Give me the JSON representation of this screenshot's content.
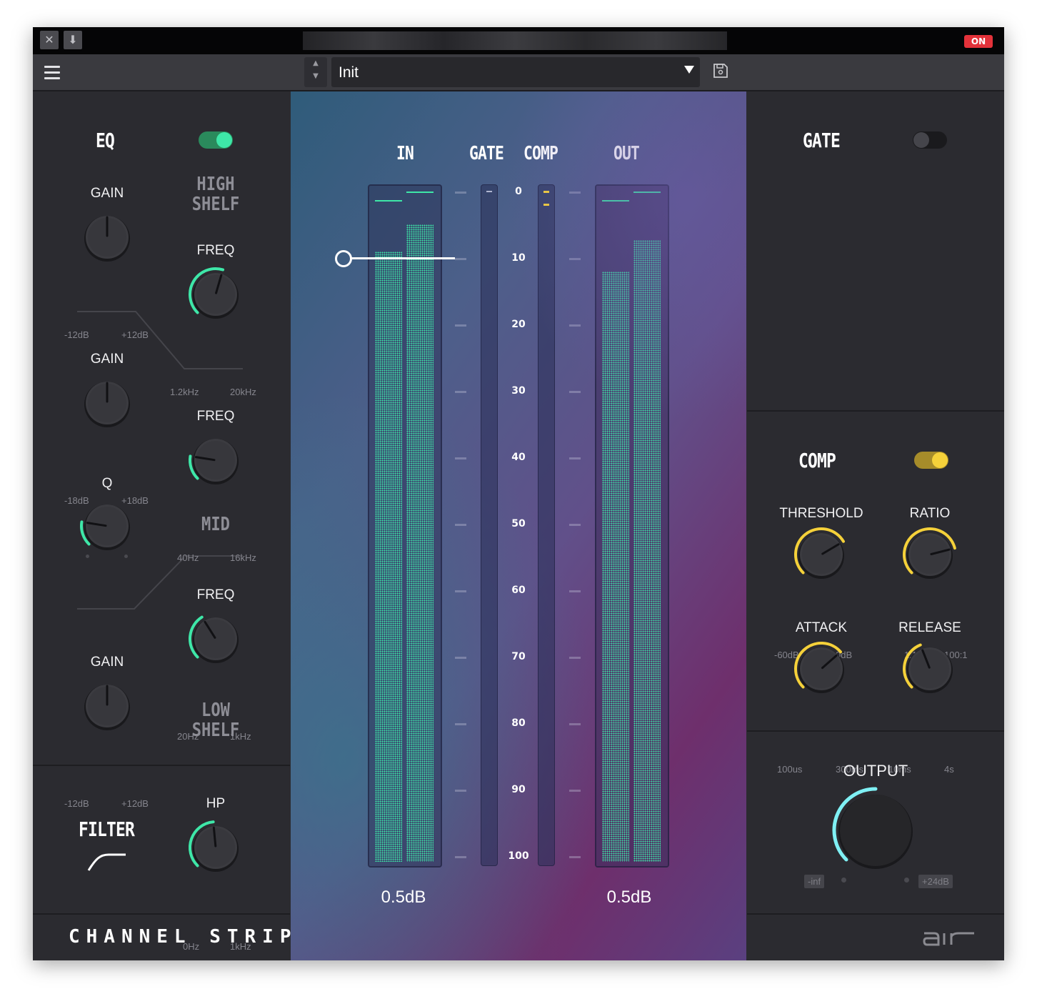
{
  "titlebar": {
    "on_badge": "ON"
  },
  "preset": {
    "name": "Init"
  },
  "eq": {
    "title": "EQ",
    "enabled": true,
    "high_shelf": {
      "name_line1": "HIGH",
      "name_line2": "SHELF",
      "gain": {
        "label": "GAIN",
        "min": "-12dB",
        "max": "+12dB",
        "value_fraction": 0.5
      },
      "freq": {
        "label": "FREQ",
        "min": "1.2kHz",
        "max": "20kHz",
        "value_fraction": 0.56
      }
    },
    "mid": {
      "name": "MID",
      "gain": {
        "label": "GAIN",
        "min": "-18dB",
        "max": "+18dB",
        "value_fraction": 0.5
      },
      "freq": {
        "label": "FREQ",
        "min": "40Hz",
        "max": "16kHz",
        "value_fraction": 0.2
      },
      "q": {
        "label": "Q",
        "value_fraction": 0.2
      }
    },
    "low_shelf": {
      "name_line1": "LOW",
      "name_line2": "SHELF",
      "gain": {
        "label": "GAIN",
        "min": "-12dB",
        "max": "+12dB",
        "value_fraction": 0.5
      },
      "freq": {
        "label": "FREQ",
        "min": "20Hz",
        "max": "1kHz",
        "value_fraction": 0.38
      }
    }
  },
  "filter": {
    "title": "FILTER",
    "hp": {
      "label": "HP",
      "min": "0Hz",
      "max": "1kHz",
      "value_fraction": 0.48
    }
  },
  "brand": "CHANNEL STRIP",
  "meters": {
    "in_label": "IN",
    "gate_label": "GATE",
    "comp_label": "COMP",
    "out_label": "OUT",
    "scale": [
      "0",
      "10",
      "20",
      "30",
      "40",
      "50",
      "60",
      "70",
      "80",
      "90",
      "100"
    ],
    "in_value": "0.5dB",
    "out_value": "0.5dB",
    "in_levels": [
      0.912,
      0.953
    ],
    "out_levels": [
      0.882,
      0.93
    ],
    "gate_threshold_scale": 10
  },
  "gate": {
    "title": "GATE",
    "enabled": false
  },
  "comp": {
    "title": "COMP",
    "enabled": true,
    "threshold": {
      "label": "THRESHOLD",
      "min": "-60dB",
      "max": "0dB",
      "value_fraction": 0.72
    },
    "ratio": {
      "label": "RATIO",
      "min": "1:1",
      "max": "100:1",
      "value_fraction": 0.78
    },
    "attack": {
      "label": "ATTACK",
      "min": "100us",
      "max": "300ms",
      "value_fraction": 0.68
    },
    "release": {
      "label": "RELEASE",
      "min": "10ms",
      "max": "4s",
      "value_fraction": 0.42
    }
  },
  "output": {
    "label": "OUTPUT",
    "min": "-inf",
    "max": "+24dB",
    "value_fraction": 0.5
  },
  "logo": "air",
  "colors": {
    "eq_accent": "#3ee7a8",
    "comp_accent": "#f5d13a",
    "output_accent": "#7ff0f4",
    "on_badge": "#e3323a"
  }
}
